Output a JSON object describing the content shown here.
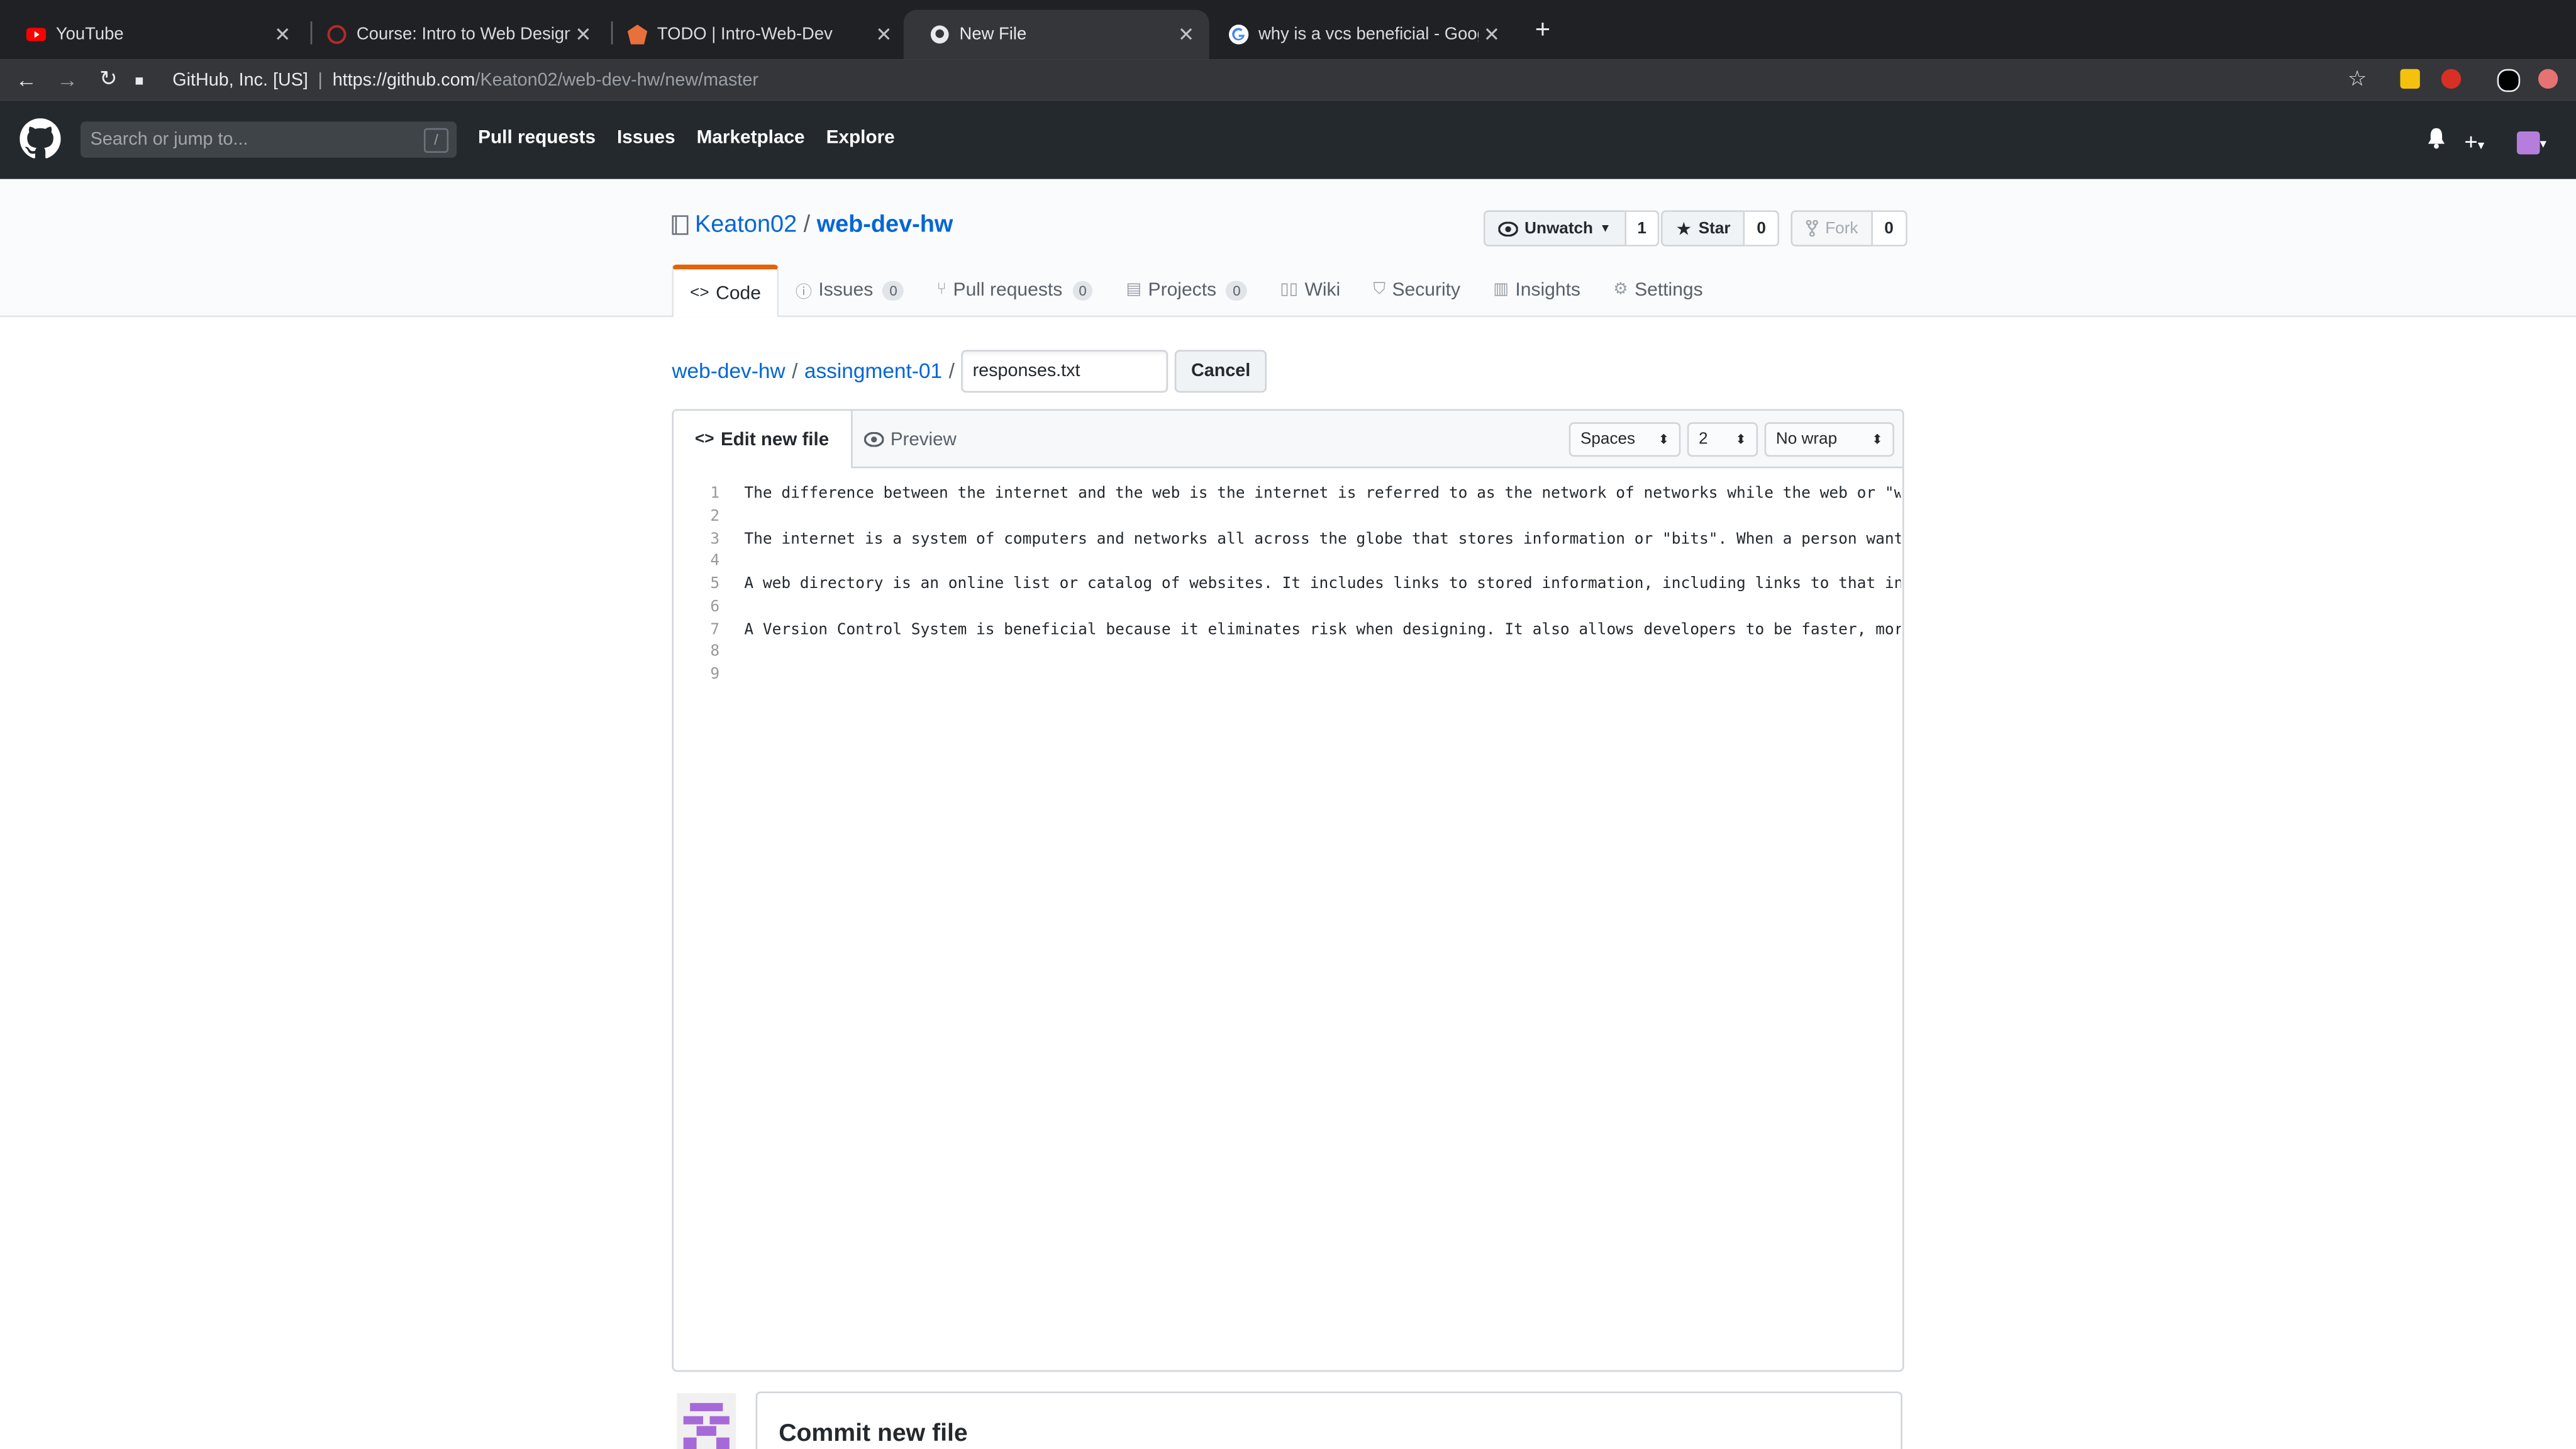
{
  "browser": {
    "tabs": [
      {
        "title": "YouTube",
        "favicon": "youtube-icon",
        "active": false
      },
      {
        "title": "Course: Intro to Web Design | ",
        "favicon": "course-icon",
        "active": false
      },
      {
        "title": "TODO | Intro-Web-Dev",
        "favicon": "todo-icon",
        "active": false
      },
      {
        "title": "New File",
        "favicon": "github-icon",
        "active": true
      },
      {
        "title": "why is a vcs beneficial - Googl",
        "favicon": "google-icon",
        "active": false
      }
    ],
    "cert": "GitHub, Inc. [US]",
    "url_host": "https://github.com",
    "url_path": "/Keaton02/web-dev-hw/new/master"
  },
  "github_header": {
    "search_placeholder": "Search or jump to...",
    "search_key": "/",
    "nav": [
      "Pull requests",
      "Issues",
      "Marketplace",
      "Explore"
    ]
  },
  "repo": {
    "owner": "Keaton02",
    "name": "web-dev-hw",
    "watch_label": "Unwatch",
    "watch_count": "1",
    "star_label": "Star",
    "star_count": "0",
    "fork_label": "Fork",
    "fork_count": "0",
    "tabs": [
      {
        "label": "Code",
        "icon": "code-icon",
        "count": null
      },
      {
        "label": "Issues",
        "icon": "issue-icon",
        "count": "0"
      },
      {
        "label": "Pull requests",
        "icon": "pull-request-icon",
        "count": "0"
      },
      {
        "label": "Projects",
        "icon": "project-icon",
        "count": "0"
      },
      {
        "label": "Wiki",
        "icon": "book-icon",
        "count": null
      },
      {
        "label": "Security",
        "icon": "shield-icon",
        "count": null
      },
      {
        "label": "Insights",
        "icon": "graph-icon",
        "count": null
      },
      {
        "label": "Settings",
        "icon": "gear-icon",
        "count": null
      }
    ]
  },
  "breadcrumb": {
    "root": "web-dev-hw",
    "folder": "assingment-01",
    "sep": "/",
    "filename": "responses.txt",
    "cancel_label": "Cancel"
  },
  "editor": {
    "edit_tab": "Edit new file",
    "preview_tab": "Preview",
    "indent_mode": "Spaces",
    "indent_size": "2",
    "wrap_mode": "No wrap",
    "lines": [
      {
        "n": "1",
        "text": "The difference between the internet and the web is the internet is referred to as the network of networks while the web or \"worl"
      },
      {
        "n": "2",
        "text": ""
      },
      {
        "n": "3",
        "text": "The internet is a system of computers and networks all across the globe that stores information or \"bits\". When a person wants a"
      },
      {
        "n": "4",
        "text": ""
      },
      {
        "n": "5",
        "text": "A web directory is an online list or catalog of websites. It includes links to stored information, including links to that infor"
      },
      {
        "n": "6",
        "text": ""
      },
      {
        "n": "7",
        "text": "A Version Control System is beneficial because it eliminates risk when designing. It also allows developers to be faster, more e"
      },
      {
        "n": "8",
        "text": ""
      },
      {
        "n": "9",
        "text": ""
      }
    ]
  },
  "commit": {
    "title": "Commit new file"
  },
  "colors": {
    "link": "#0366d6",
    "header_bg": "#24292e",
    "selected_tab_accent": "#e36209"
  }
}
